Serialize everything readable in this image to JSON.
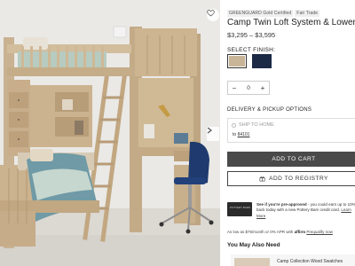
{
  "product": {
    "badges": [
      "GREENGUARD Gold Certified",
      "Fair Trade"
    ],
    "title": "Camp Twin Loft System & Lower Bed",
    "price": "$3,295 – $3,595"
  },
  "finish": {
    "label": "SELECT FINISH:",
    "swatches": [
      {
        "name": "weathered-natural",
        "color": "#c8b597"
      },
      {
        "name": "navy",
        "color": "#1c2a45"
      }
    ]
  },
  "quantity": {
    "minus": "−",
    "value": "0",
    "plus": "+"
  },
  "delivery": {
    "label": "DELIVERY & PICKUP OPTIONS",
    "ship_to_home": "SHIP TO HOME",
    "zip_prefix": "to",
    "zip": "84101"
  },
  "actions": {
    "add_to_cart": "ADD TO CART",
    "add_to_registry": "ADD TO REGISTRY"
  },
  "promo": {
    "card_label": "POTTERY BARN",
    "bold": "See if you're pre-approved",
    "text": " - you could earn up to 10% back today with a new Pottery Barn credit card.",
    "link": "Learn More"
  },
  "affirm": {
    "text": "As low as $76/month or 0% APR with",
    "brand": "affirm",
    "link": "Prequalify now"
  },
  "also_like": {
    "title": "You May Also Need",
    "item": "Camp Collection Wood Swatches"
  },
  "colors": {
    "cart_button": "#4a4a4a",
    "wood": "#c9b291",
    "chair": "#1f3a6e"
  }
}
